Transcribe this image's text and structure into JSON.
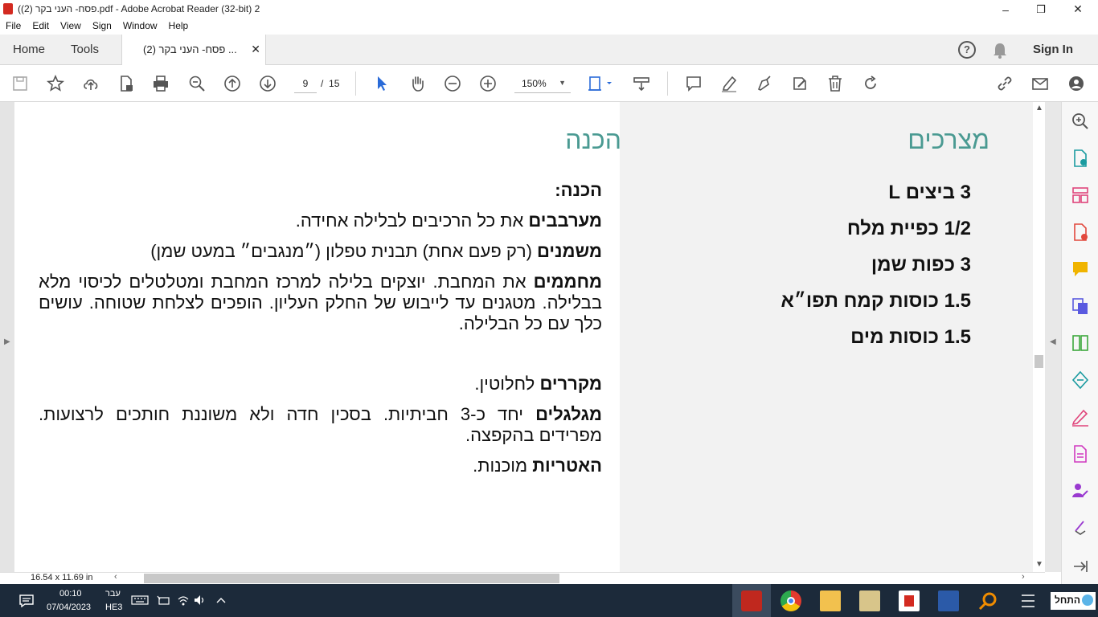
{
  "window": {
    "title": "(פסח- העני בקר (2).pdf - Adobe Acrobat Reader (32-bit) 2",
    "minimize": "–",
    "maximize": "❒",
    "close": "✕"
  },
  "menu": [
    "File",
    "Edit",
    "View",
    "Sign",
    "Window",
    "Help"
  ],
  "tabs": {
    "home": "Home",
    "tools": "Tools",
    "doc": "פסח- העני בקר (2) ...",
    "close": "✕",
    "signin": "Sign In"
  },
  "toolbar": {
    "page_current": "9",
    "page_sep": "/",
    "page_total": "15",
    "zoom": "150%"
  },
  "document": {
    "heading_ingredients": "מצרכים",
    "heading_prep": "הכנה",
    "ingredients": [
      "3 ביצים L",
      "1/2 כפיית מלח",
      "3 כפות שמן",
      "1.5 כוסות קמח תפו״א",
      "1.5 כוסות מים"
    ],
    "prep_title": "הכנה:",
    "steps": [
      {
        "bold": "מערבבים",
        "text": " את כל הרכיבים לבלילה אחידה."
      },
      {
        "bold": "משמנים",
        "text": " (רק פעם אחת) תבנית טפלון (״מנגבים״ במעט שמן)"
      },
      {
        "bold": "מחממים",
        "text": " את המחבת. יוצקים בלילה למרכז המחבת ומטלטלים לכיסוי מלא בבלילה. מטגנים עד לייבוש של החלק העליון. הופכים לצלחת שטוחה. עושים כלך עם כל הבלילה."
      },
      {
        "bold": "מקררים",
        "text": " לחלוטין."
      },
      {
        "bold": "מגלגלים",
        "text": " יחד כ-3 חביתיות. בסכין חדה ולא משוננת חותכים לרצועות. מפרידים בהקפצה."
      },
      {
        "bold": "האטריות",
        "text": " מוכנות."
      }
    ]
  },
  "status": {
    "page_size": "16.54 x 11.69 in"
  },
  "taskbar": {
    "time": "00:10",
    "date": "07/04/2023",
    "lang_top": "עבר",
    "lang_bottom": "HE3",
    "start": "התחל"
  },
  "colors": {
    "heading": "#4a9a92",
    "accent": "#2a6bd8",
    "taskbar": "#1c2a3a"
  }
}
